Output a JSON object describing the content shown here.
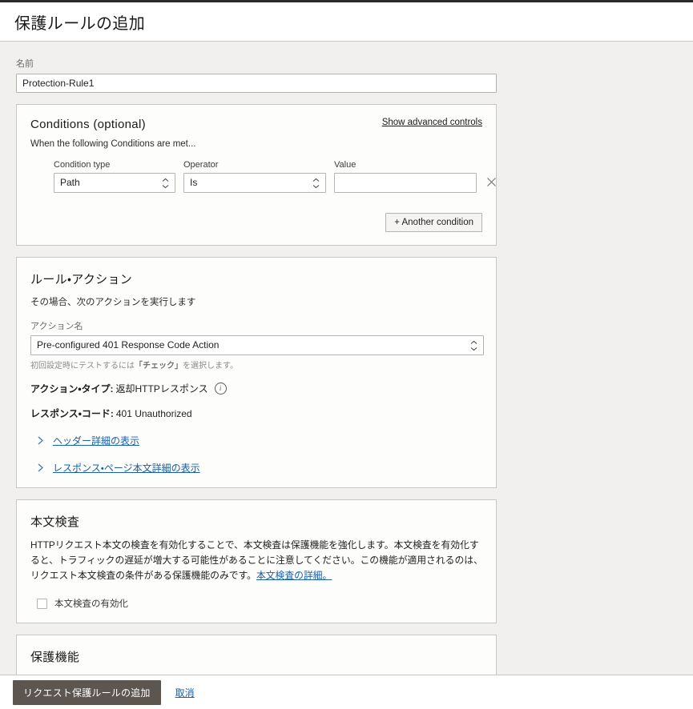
{
  "header": {
    "title": "保護ルールの追加"
  },
  "name_field": {
    "label": "名前",
    "value": "Protection-Rule1"
  },
  "conditions": {
    "title": "Conditions (optional)",
    "advanced_link": "Show advanced controls",
    "subtitle": "When the following Conditions are met...",
    "columns": {
      "condition_type": "Condition type",
      "operator": "Operator",
      "value": "Value"
    },
    "row": {
      "condition_type_value": "Path",
      "operator_value": "Is",
      "value_value": "",
      "value_placeholder": "",
      "remove_icon": "close-icon"
    },
    "add_button": "+ Another condition"
  },
  "rule_action": {
    "title": "ルール・アクション",
    "subtitle": "その場合、次のアクションを実行します",
    "action_name_label": "アクション名",
    "action_name_value": "Pre-configured 401 Response Code Action",
    "hint_prefix": "初回設定時にテストするには",
    "hint_bold": "「チェック」",
    "hint_suffix": "を選択します。",
    "action_type_key": "アクション・タイプ:",
    "action_type_value": "返却HTTPレスポンス",
    "info_icon": "info-icon",
    "response_code_key": "レスポンス・コード:",
    "response_code_value": "401 Unauthorized",
    "disclosures": [
      {
        "label": "ヘッダー詳細の表示",
        "icon": "chevron-right-icon"
      },
      {
        "label": "レスポンス・ページ本文詳細の表示",
        "icon": "chevron-right-icon"
      }
    ]
  },
  "body_inspection": {
    "title": "本文検査",
    "description": "HTTPリクエスト本文の検査を有効化することで、本文検査は保護機能を強化します。本文検査を有効化すると、トラフィックの遅延が増大する可能性があることに注意してください。この機能が適用されるのは、リクエスト本文検査の条件がある保護機能のみです。",
    "description_link": "本文検査の詳細。",
    "checkbox_label": "本文検査の有効化",
    "checkbox_checked": false
  },
  "protection_features": {
    "title": "保護機能"
  },
  "footer": {
    "submit_label": "リクエスト保護ルールの追加",
    "cancel_label": "取消"
  },
  "colors": {
    "accent_button": "#5c5550",
    "link": "#1960a6",
    "page_background": "#f1f0ee",
    "card_background": "#fdfdfc",
    "border": "#c9c7c4"
  }
}
